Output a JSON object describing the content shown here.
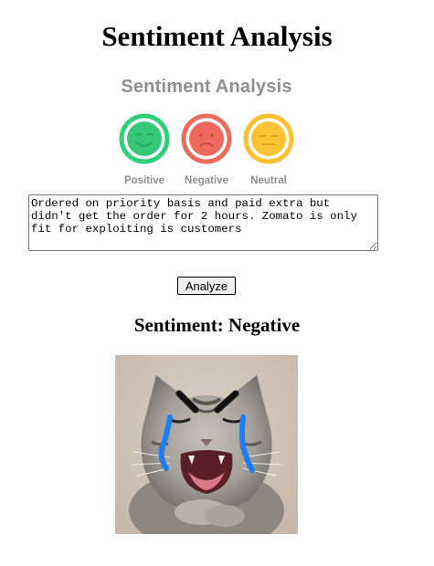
{
  "page": {
    "title": "Sentiment Analysis"
  },
  "banner": {
    "title": "Sentiment Analysis",
    "faces": [
      {
        "label": "Positive",
        "color": "#34c878",
        "ring": "#2fd07a",
        "icon": "smiling-face-icon"
      },
      {
        "label": "Negative",
        "color": "#ec6a5c",
        "ring": "#eb6a5a",
        "icon": "sad-face-icon"
      },
      {
        "label": "Neutral",
        "color": "#fdc334",
        "ring": "#fcc12e",
        "icon": "neutral-face-icon"
      }
    ]
  },
  "form": {
    "input_value": "Ordered on priority basis and paid extra but didn't get the order for 2 hours. Zomato is only fit for exploiting is customers",
    "analyze_label": "Analyze"
  },
  "result": {
    "text": "Sentiment: Negative"
  },
  "colors": {
    "label_gray": "#8e8e93",
    "tear_blue": "#1e7df0"
  }
}
